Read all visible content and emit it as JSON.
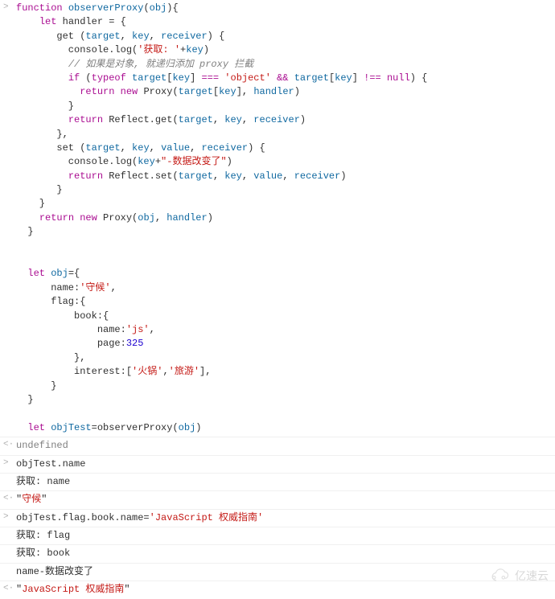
{
  "entries": [
    {
      "marker": ">",
      "type": "code",
      "tokens": [
        [
          [
            "kw",
            "function"
          ],
          [
            "",
            " "
          ],
          [
            "blue",
            "observerProxy"
          ],
          [
            "",
            "("
          ],
          [
            "blue",
            "obj"
          ],
          [
            "",
            "){"
          ]
        ],
        [
          [
            "",
            "    "
          ],
          [
            "kw",
            "let"
          ],
          [
            "",
            " handler = {"
          ]
        ],
        [
          [
            "",
            "       get ("
          ],
          [
            "blue",
            "target"
          ],
          [
            "",
            ", "
          ],
          [
            "blue",
            "key"
          ],
          [
            "",
            ", "
          ],
          [
            "blue",
            "receiver"
          ],
          [
            "",
            ") {"
          ]
        ],
        [
          [
            "",
            "         console.log("
          ],
          [
            "str",
            "'获取: '"
          ],
          [
            "",
            "+"
          ],
          [
            "blue",
            "key"
          ],
          [
            "",
            ")"
          ]
        ],
        [
          [
            "",
            "         "
          ],
          [
            "comment",
            "// 如果是对象, 就递归添加 proxy 拦截"
          ]
        ],
        [
          [
            "",
            "         "
          ],
          [
            "kw",
            "if"
          ],
          [
            "",
            " ("
          ],
          [
            "kw",
            "typeof"
          ],
          [
            "",
            " "
          ],
          [
            "blue",
            "target"
          ],
          [
            "",
            "["
          ],
          [
            "blue",
            "key"
          ],
          [
            "",
            "] "
          ],
          [
            "op",
            "==="
          ],
          [
            "",
            " "
          ],
          [
            "str",
            "'object'"
          ],
          [
            "",
            " "
          ],
          [
            "op",
            "&&"
          ],
          [
            "",
            " "
          ],
          [
            "blue",
            "target"
          ],
          [
            "",
            "["
          ],
          [
            "blue",
            "key"
          ],
          [
            "",
            "] "
          ],
          [
            "op",
            "!=="
          ],
          [
            "",
            " "
          ],
          [
            "kw",
            "null"
          ],
          [
            "",
            ") {"
          ]
        ],
        [
          [
            "",
            "           "
          ],
          [
            "kw",
            "return"
          ],
          [
            "",
            " "
          ],
          [
            "kw",
            "new"
          ],
          [
            "",
            " Proxy("
          ],
          [
            "blue",
            "target"
          ],
          [
            "",
            "["
          ],
          [
            "blue",
            "key"
          ],
          [
            "",
            "], "
          ],
          [
            "blue",
            "handler"
          ],
          [
            "",
            ")"
          ]
        ],
        [
          [
            "",
            "         }"
          ]
        ],
        [
          [
            "",
            "         "
          ],
          [
            "kw",
            "return"
          ],
          [
            "",
            " Reflect.get("
          ],
          [
            "blue",
            "target"
          ],
          [
            "",
            ", "
          ],
          [
            "blue",
            "key"
          ],
          [
            "",
            ", "
          ],
          [
            "blue",
            "receiver"
          ],
          [
            "",
            ")"
          ]
        ],
        [
          [
            "",
            "       },"
          ]
        ],
        [
          [
            "",
            "       set ("
          ],
          [
            "blue",
            "target"
          ],
          [
            "",
            ", "
          ],
          [
            "blue",
            "key"
          ],
          [
            "",
            ", "
          ],
          [
            "blue",
            "value"
          ],
          [
            "",
            ", "
          ],
          [
            "blue",
            "receiver"
          ],
          [
            "",
            ") {"
          ]
        ],
        [
          [
            "",
            "         console.log("
          ],
          [
            "blue",
            "key"
          ],
          [
            "",
            "+"
          ],
          [
            "str",
            "\"-数据改变了\""
          ],
          [
            "",
            ")"
          ]
        ],
        [
          [
            "",
            "         "
          ],
          [
            "kw",
            "return"
          ],
          [
            "",
            " Reflect.set("
          ],
          [
            "blue",
            "target"
          ],
          [
            "",
            ", "
          ],
          [
            "blue",
            "key"
          ],
          [
            "",
            ", "
          ],
          [
            "blue",
            "value"
          ],
          [
            "",
            ", "
          ],
          [
            "blue",
            "receiver"
          ],
          [
            "",
            ")"
          ]
        ],
        [
          [
            "",
            "       }"
          ]
        ],
        [
          [
            "",
            "    }"
          ]
        ],
        [
          [
            "",
            "    "
          ],
          [
            "kw",
            "return"
          ],
          [
            "",
            " "
          ],
          [
            "kw",
            "new"
          ],
          [
            "",
            " Proxy("
          ],
          [
            "blue",
            "obj"
          ],
          [
            "",
            ", "
          ],
          [
            "blue",
            "handler"
          ],
          [
            "",
            ")"
          ]
        ],
        [
          [
            "",
            "  }"
          ]
        ],
        [
          [
            "",
            ""
          ]
        ],
        [
          [
            "",
            ""
          ]
        ],
        [
          [
            "",
            "  "
          ],
          [
            "kw",
            "let"
          ],
          [
            "",
            " "
          ],
          [
            "blue",
            "obj"
          ],
          [
            "",
            "={"
          ]
        ],
        [
          [
            "",
            "      name:"
          ],
          [
            "str",
            "'守候'"
          ],
          [
            "",
            ","
          ]
        ],
        [
          [
            "",
            "      flag:{"
          ]
        ],
        [
          [
            "",
            "          book:{"
          ]
        ],
        [
          [
            "",
            "              name:"
          ],
          [
            "str",
            "'js'"
          ],
          [
            "",
            ","
          ]
        ],
        [
          [
            "",
            "              page:"
          ],
          [
            "num",
            "325"
          ]
        ],
        [
          [
            "",
            "          },"
          ]
        ],
        [
          [
            "",
            "          interest:["
          ],
          [
            "str",
            "'火锅'"
          ],
          [
            "",
            ","
          ],
          [
            "str",
            "'旅游'"
          ],
          [
            "",
            "],"
          ]
        ],
        [
          [
            "",
            "      }"
          ]
        ],
        [
          [
            "",
            "  }"
          ]
        ],
        [
          [
            "",
            ""
          ]
        ],
        [
          [
            "",
            "  "
          ],
          [
            "kw",
            "let"
          ],
          [
            "",
            " "
          ],
          [
            "blue",
            "objTest"
          ],
          [
            "",
            "=observerProxy("
          ],
          [
            "blue",
            "obj"
          ],
          [
            "",
            ")"
          ]
        ]
      ]
    },
    {
      "marker": "<·",
      "type": "result",
      "tokens": [
        [
          [
            "und",
            "undefined"
          ]
        ]
      ]
    },
    {
      "marker": ">",
      "type": "code",
      "tokens": [
        [
          [
            "",
            "objTest.name"
          ]
        ]
      ]
    },
    {
      "marker": "",
      "type": "log",
      "tokens": [
        [
          [
            "",
            "获取: name"
          ]
        ]
      ]
    },
    {
      "marker": "<·",
      "type": "result",
      "tokens": [
        [
          [
            "",
            "\""
          ],
          [
            "resStr",
            "守候"
          ],
          [
            "",
            "\""
          ]
        ]
      ]
    },
    {
      "marker": ">",
      "type": "code",
      "tokens": [
        [
          [
            "",
            "objTest.flag.book.name="
          ],
          [
            "str",
            "'JavaScript 权威指南'"
          ]
        ]
      ]
    },
    {
      "marker": "",
      "type": "log",
      "tokens": [
        [
          [
            "",
            "获取: flag"
          ]
        ]
      ]
    },
    {
      "marker": "",
      "type": "log",
      "tokens": [
        [
          [
            "",
            "获取: book"
          ]
        ]
      ]
    },
    {
      "marker": "",
      "type": "log",
      "tokens": [
        [
          [
            "",
            "name-数据改变了"
          ]
        ]
      ]
    },
    {
      "marker": "<·",
      "type": "result",
      "tokens": [
        [
          [
            "",
            "\""
          ],
          [
            "resStr",
            "JavaScript 权威指南"
          ],
          [
            "",
            "\""
          ]
        ]
      ]
    }
  ],
  "watermark": "亿速云"
}
